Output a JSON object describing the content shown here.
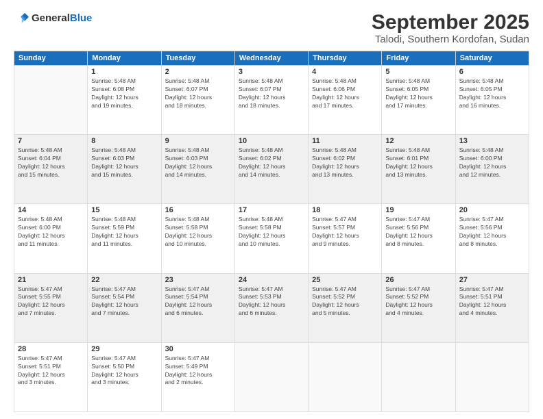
{
  "header": {
    "logo_general": "General",
    "logo_blue": "Blue",
    "month_year": "September 2025",
    "location": "Talodi, Southern Kordofan, Sudan"
  },
  "weekdays": [
    "Sunday",
    "Monday",
    "Tuesday",
    "Wednesday",
    "Thursday",
    "Friday",
    "Saturday"
  ],
  "weeks": [
    [
      {
        "day": "",
        "info": ""
      },
      {
        "day": "1",
        "info": "Sunrise: 5:48 AM\nSunset: 6:08 PM\nDaylight: 12 hours\nand 19 minutes."
      },
      {
        "day": "2",
        "info": "Sunrise: 5:48 AM\nSunset: 6:07 PM\nDaylight: 12 hours\nand 18 minutes."
      },
      {
        "day": "3",
        "info": "Sunrise: 5:48 AM\nSunset: 6:07 PM\nDaylight: 12 hours\nand 18 minutes."
      },
      {
        "day": "4",
        "info": "Sunrise: 5:48 AM\nSunset: 6:06 PM\nDaylight: 12 hours\nand 17 minutes."
      },
      {
        "day": "5",
        "info": "Sunrise: 5:48 AM\nSunset: 6:05 PM\nDaylight: 12 hours\nand 17 minutes."
      },
      {
        "day": "6",
        "info": "Sunrise: 5:48 AM\nSunset: 6:05 PM\nDaylight: 12 hours\nand 16 minutes."
      }
    ],
    [
      {
        "day": "7",
        "info": "Sunrise: 5:48 AM\nSunset: 6:04 PM\nDaylight: 12 hours\nand 15 minutes."
      },
      {
        "day": "8",
        "info": "Sunrise: 5:48 AM\nSunset: 6:03 PM\nDaylight: 12 hours\nand 15 minutes."
      },
      {
        "day": "9",
        "info": "Sunrise: 5:48 AM\nSunset: 6:03 PM\nDaylight: 12 hours\nand 14 minutes."
      },
      {
        "day": "10",
        "info": "Sunrise: 5:48 AM\nSunset: 6:02 PM\nDaylight: 12 hours\nand 14 minutes."
      },
      {
        "day": "11",
        "info": "Sunrise: 5:48 AM\nSunset: 6:02 PM\nDaylight: 12 hours\nand 13 minutes."
      },
      {
        "day": "12",
        "info": "Sunrise: 5:48 AM\nSunset: 6:01 PM\nDaylight: 12 hours\nand 13 minutes."
      },
      {
        "day": "13",
        "info": "Sunrise: 5:48 AM\nSunset: 6:00 PM\nDaylight: 12 hours\nand 12 minutes."
      }
    ],
    [
      {
        "day": "14",
        "info": "Sunrise: 5:48 AM\nSunset: 6:00 PM\nDaylight: 12 hours\nand 11 minutes."
      },
      {
        "day": "15",
        "info": "Sunrise: 5:48 AM\nSunset: 5:59 PM\nDaylight: 12 hours\nand 11 minutes."
      },
      {
        "day": "16",
        "info": "Sunrise: 5:48 AM\nSunset: 5:58 PM\nDaylight: 12 hours\nand 10 minutes."
      },
      {
        "day": "17",
        "info": "Sunrise: 5:48 AM\nSunset: 5:58 PM\nDaylight: 12 hours\nand 10 minutes."
      },
      {
        "day": "18",
        "info": "Sunrise: 5:47 AM\nSunset: 5:57 PM\nDaylight: 12 hours\nand 9 minutes."
      },
      {
        "day": "19",
        "info": "Sunrise: 5:47 AM\nSunset: 5:56 PM\nDaylight: 12 hours\nand 8 minutes."
      },
      {
        "day": "20",
        "info": "Sunrise: 5:47 AM\nSunset: 5:56 PM\nDaylight: 12 hours\nand 8 minutes."
      }
    ],
    [
      {
        "day": "21",
        "info": "Sunrise: 5:47 AM\nSunset: 5:55 PM\nDaylight: 12 hours\nand 7 minutes."
      },
      {
        "day": "22",
        "info": "Sunrise: 5:47 AM\nSunset: 5:54 PM\nDaylight: 12 hours\nand 7 minutes."
      },
      {
        "day": "23",
        "info": "Sunrise: 5:47 AM\nSunset: 5:54 PM\nDaylight: 12 hours\nand 6 minutes."
      },
      {
        "day": "24",
        "info": "Sunrise: 5:47 AM\nSunset: 5:53 PM\nDaylight: 12 hours\nand 6 minutes."
      },
      {
        "day": "25",
        "info": "Sunrise: 5:47 AM\nSunset: 5:52 PM\nDaylight: 12 hours\nand 5 minutes."
      },
      {
        "day": "26",
        "info": "Sunrise: 5:47 AM\nSunset: 5:52 PM\nDaylight: 12 hours\nand 4 minutes."
      },
      {
        "day": "27",
        "info": "Sunrise: 5:47 AM\nSunset: 5:51 PM\nDaylight: 12 hours\nand 4 minutes."
      }
    ],
    [
      {
        "day": "28",
        "info": "Sunrise: 5:47 AM\nSunset: 5:51 PM\nDaylight: 12 hours\nand 3 minutes."
      },
      {
        "day": "29",
        "info": "Sunrise: 5:47 AM\nSunset: 5:50 PM\nDaylight: 12 hours\nand 3 minutes."
      },
      {
        "day": "30",
        "info": "Sunrise: 5:47 AM\nSunset: 5:49 PM\nDaylight: 12 hours\nand 2 minutes."
      },
      {
        "day": "",
        "info": ""
      },
      {
        "day": "",
        "info": ""
      },
      {
        "day": "",
        "info": ""
      },
      {
        "day": "",
        "info": ""
      }
    ]
  ]
}
